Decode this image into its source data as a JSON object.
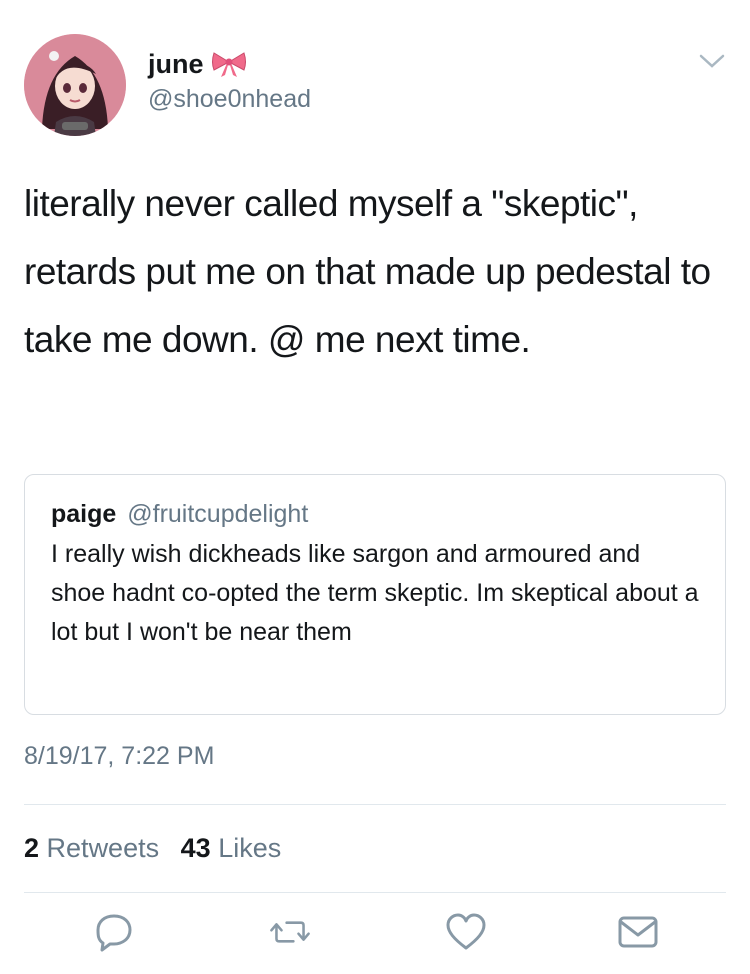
{
  "tweet": {
    "author": {
      "display_name": "june",
      "handle": "@shoe0nhead",
      "avatar_icon": "anime-girl-avatar-icon",
      "name_emoji": "ribbon-bow-icon"
    },
    "text": "literally never called myself a \"skeptic\", retards put me on that made up pedestal to take me down. @ me next time.",
    "quoted": {
      "display_name": "paige",
      "handle": "@fruitcupdelight",
      "text": "I really wish dickheads like sargon and armoured and shoe hadnt co-opted the term skeptic. Im skeptical about a lot but I won't be near them"
    },
    "timestamp": "8/19/17, 7:22 PM",
    "stats": {
      "retweets_count": "2",
      "retweets_label": "Retweets",
      "likes_count": "43",
      "likes_label": "Likes"
    }
  },
  "actions": {
    "reply_icon": "reply-icon",
    "retweet_icon": "retweet-icon",
    "like_icon": "heart-icon",
    "dm_icon": "envelope-icon"
  },
  "colors": {
    "text_primary": "#14171a",
    "text_secondary": "#657786",
    "border": "#d8dde2",
    "bow_pink": "#f06a8a"
  }
}
